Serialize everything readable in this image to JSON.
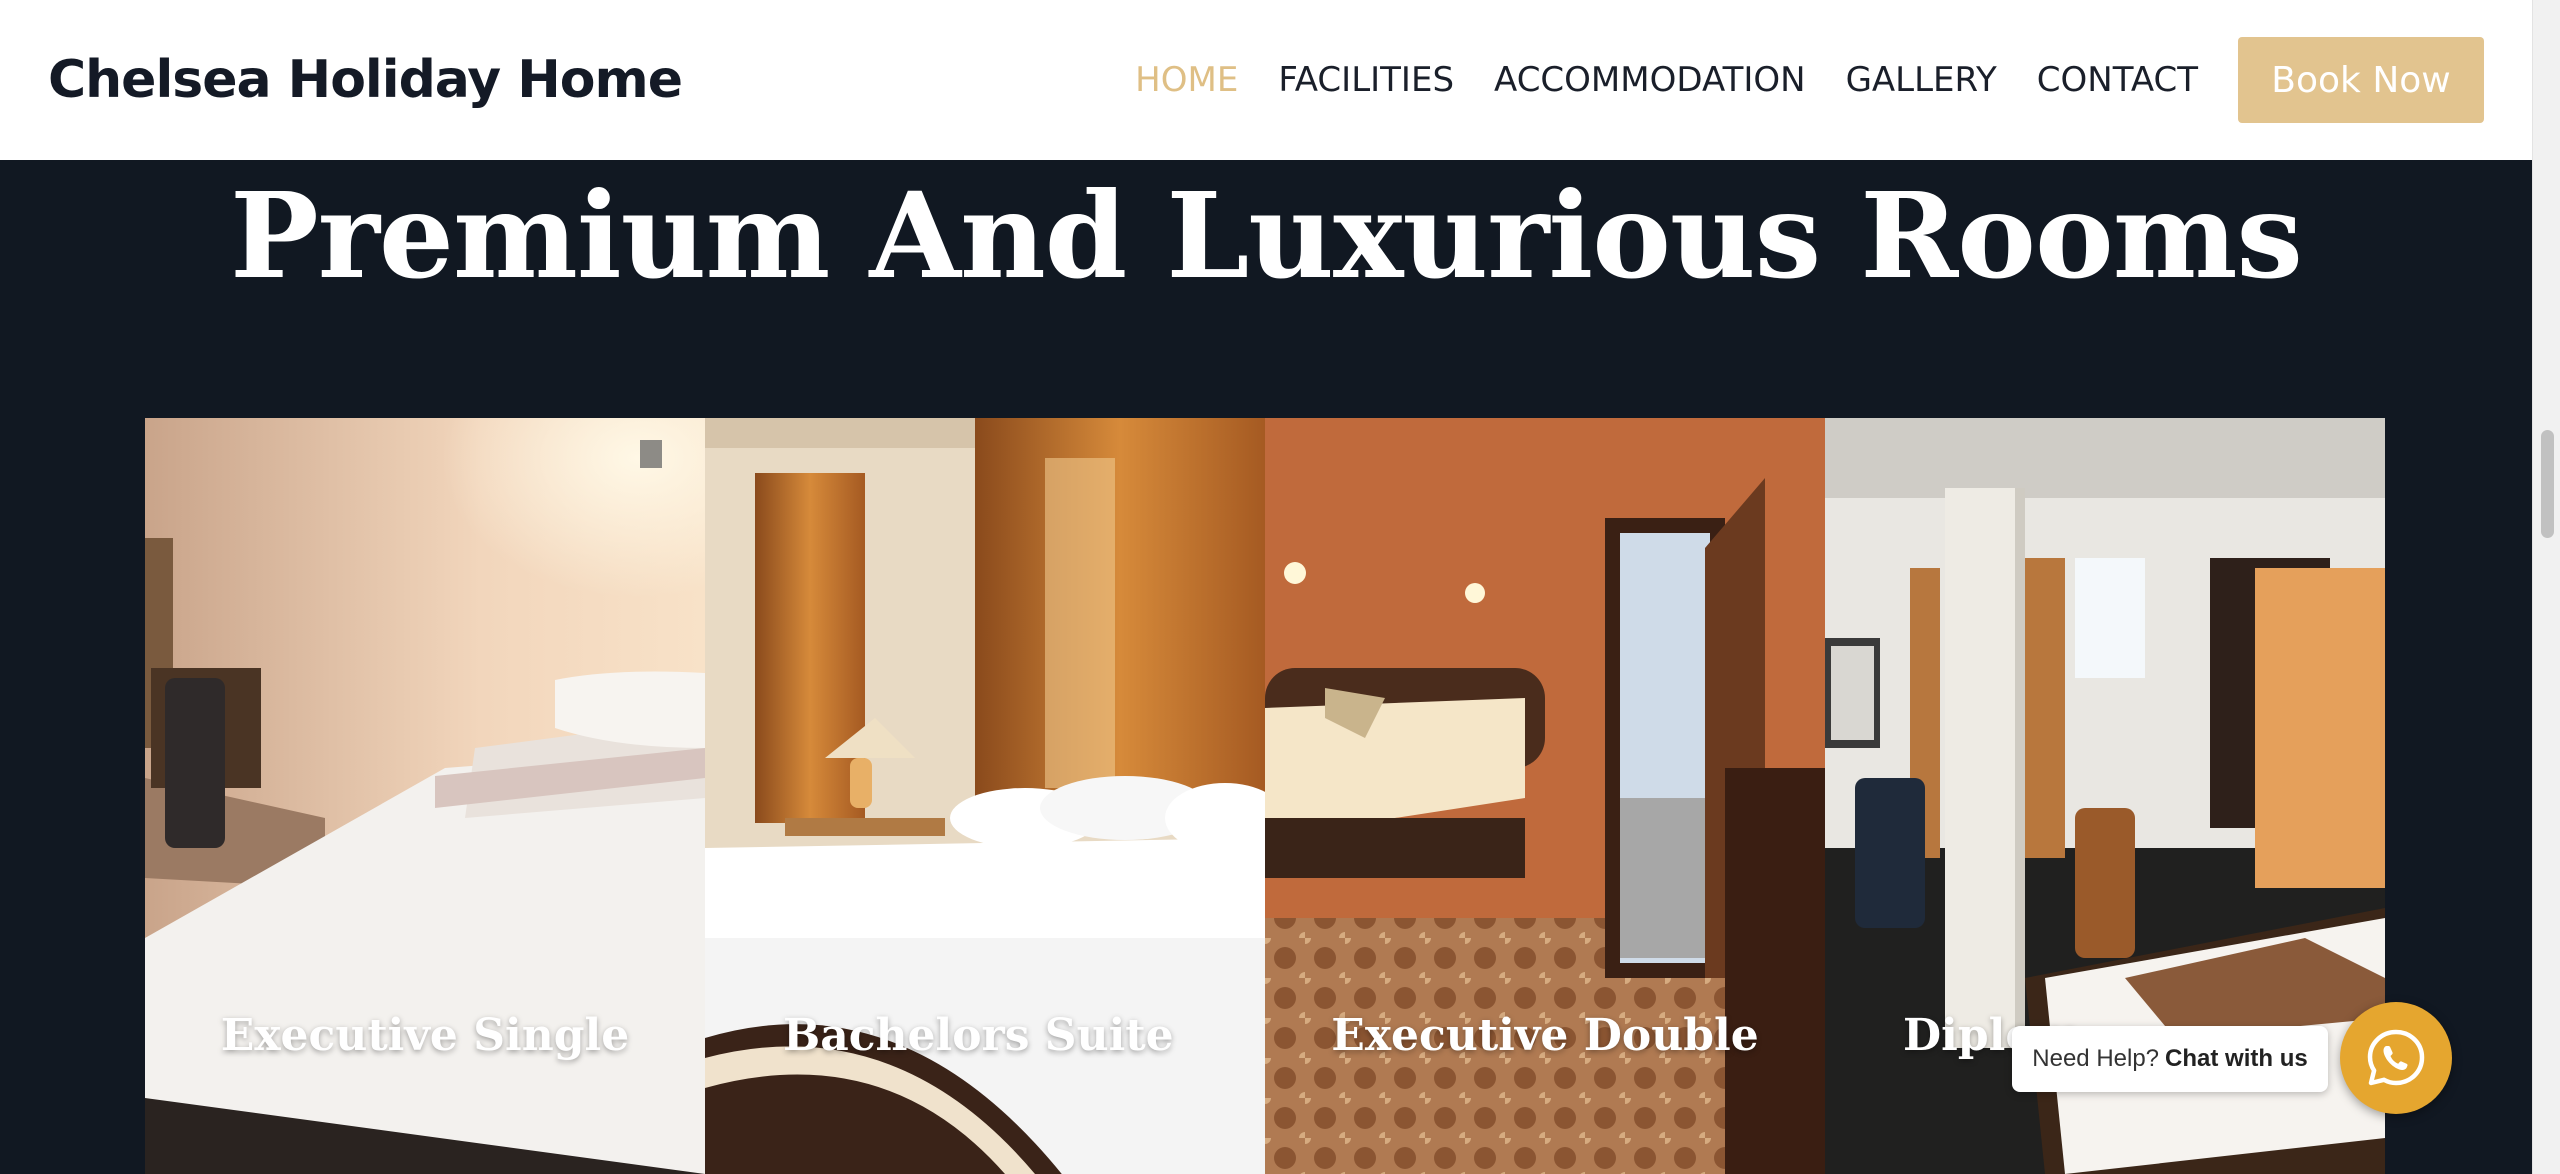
{
  "header": {
    "brand": "Chelsea Holiday Home",
    "nav": [
      {
        "label": "HOME",
        "active": true
      },
      {
        "label": "FACILITIES",
        "active": false
      },
      {
        "label": "ACCOMMODATION",
        "active": false
      },
      {
        "label": "GALLERY",
        "active": false
      },
      {
        "label": "CONTACT",
        "active": false
      }
    ],
    "cta_label": "Book Now"
  },
  "section": {
    "title": "Premium And Luxurious Rooms"
  },
  "rooms": [
    {
      "name": "Executive Single"
    },
    {
      "name": "Bachelors Suite"
    },
    {
      "name": "Executive Double"
    },
    {
      "name": "Diplom"
    }
  ],
  "chat": {
    "prefix": "Need Help?",
    "action": "Chat with us",
    "icon": "whatsapp-icon"
  },
  "colors": {
    "accent": "#dfbf85",
    "button": "#e2c48f",
    "background": "#111822",
    "whatsapp": "#e5a62f"
  }
}
